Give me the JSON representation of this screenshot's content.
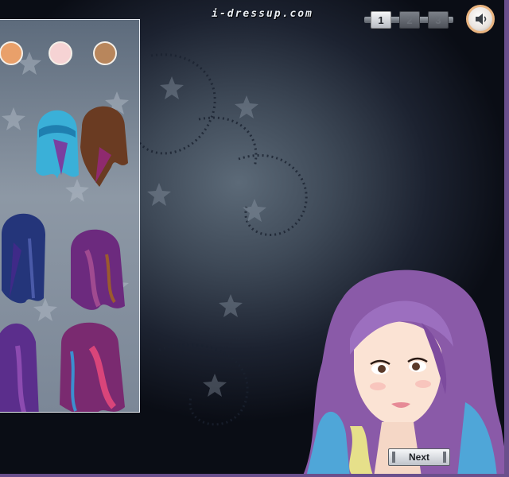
{
  "site": {
    "logo_text": "i-dressup.com"
  },
  "pager": {
    "pages": [
      "1",
      "2",
      "3"
    ],
    "active_page": "1"
  },
  "controls": {
    "sound_icon": "speaker-icon",
    "next_label": "Next"
  },
  "swatches": {
    "colors": [
      "#e9a06a",
      "#f6d3d4",
      "#b8865c"
    ]
  },
  "hair_options": [
    {
      "name": "hair-option-blue-bangs",
      "colors": [
        "#3ab0d8",
        "#7a3fa0"
      ]
    },
    {
      "name": "hair-option-brown-bob",
      "colors": [
        "#6a3b22",
        "#8f2a6e"
      ]
    },
    {
      "name": "hair-option-dark-blue-braids",
      "colors": [
        "#24357a",
        "#3f2a88"
      ]
    },
    {
      "name": "hair-option-purple-waves",
      "colors": [
        "#6c2a7e",
        "#a04a90"
      ]
    },
    {
      "name": "hair-option-violet-long",
      "colors": [
        "#5b2e8c",
        "#8c4bb0"
      ]
    },
    {
      "name": "hair-option-pink-curls",
      "colors": [
        "#7a2a70",
        "#d9457a"
      ]
    }
  ],
  "theme": {
    "frame_color": "#6a4f8c",
    "panel_border": "#e9edf3"
  }
}
